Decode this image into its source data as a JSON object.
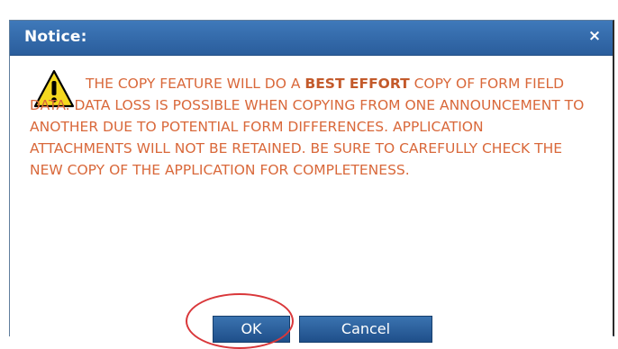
{
  "dialog": {
    "title": "Notice:",
    "close_label": "×",
    "message_part1": "THE COPY FEATURE WILL DO A ",
    "message_emphasis": "BEST EFFORT",
    "message_part2": " COPY OF FORM FIELD DATA. DATA LOSS IS POSSIBLE WHEN COPYING FROM ONE ANNOUNCEMENT TO ANOTHER DUE TO POTENTIAL FORM DIFFERENCES. APPLICATION ATTACHMENTS WILL NOT BE RETAINED. BE SURE TO CAREFULLY CHECK THE NEW COPY OF THE APPLICATION FOR COMPLETENESS.",
    "ok_label": "OK",
    "cancel_label": "Cancel"
  },
  "icons": {
    "warning": "warning-icon",
    "close": "close-icon"
  },
  "colors": {
    "titlebar": "#2f66a8",
    "message_text": "#d9683a",
    "button": "#2a5d9c",
    "highlight_ring": "#d9373a"
  }
}
